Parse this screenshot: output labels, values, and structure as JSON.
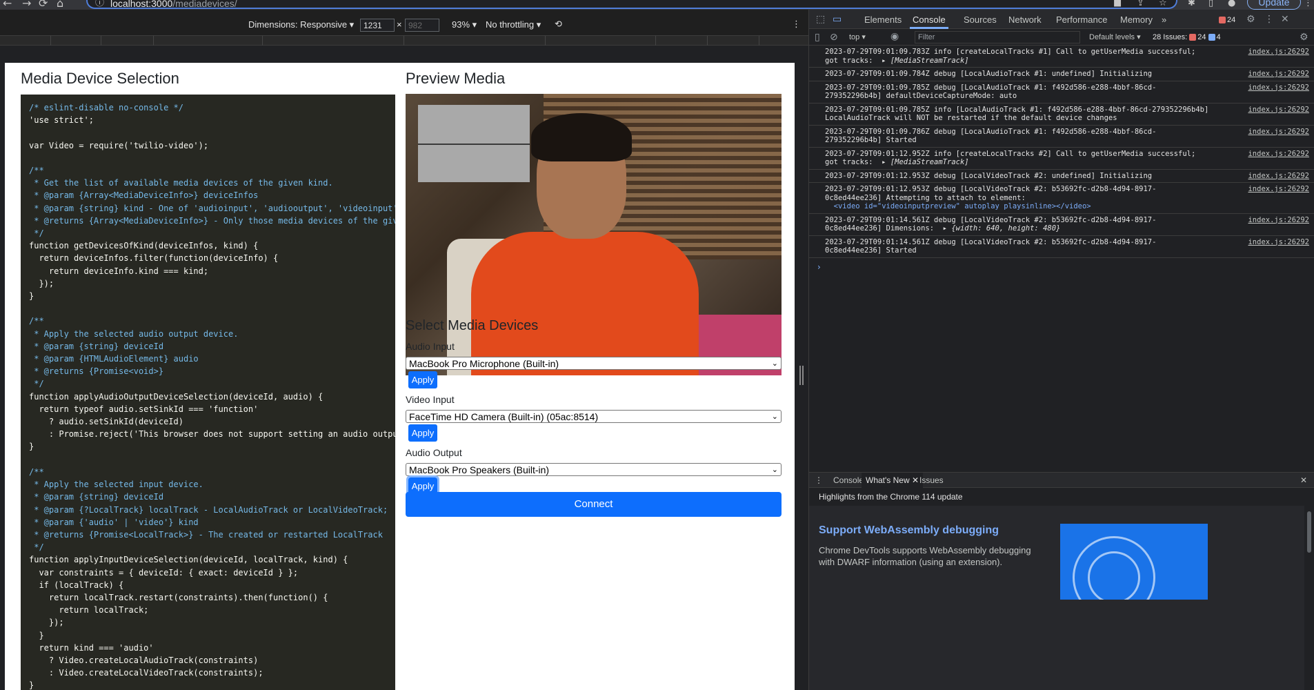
{
  "browser": {
    "url_host": "localhost:3000",
    "url_path": "/mediadevices/",
    "update_label": "Update"
  },
  "device_toolbar": {
    "dimensions_label": "Dimensions: Responsive ▾",
    "width": "1231",
    "height": "982",
    "times": "×",
    "zoom": "93% ▾",
    "throttling": "No throttling ▾"
  },
  "page": {
    "heading_left": "Media Device Selection",
    "heading_right": "Preview Media",
    "select_heading": "Select Media Devices",
    "audio_input_label": "Audio Input",
    "audio_input_value": "MacBook Pro Microphone (Built-in)",
    "video_input_label": "Video Input",
    "video_input_value": "FaceTime HD Camera (Built-in) (05ac:8514)",
    "audio_output_label": "Audio Output",
    "audio_output_value": "MacBook Pro Speakers (Built-in)",
    "apply_label": "Apply",
    "connect_label": "Connect"
  },
  "code_lines": [
    "/* eslint-disable no-console */",
    "'use strict';",
    "",
    "var Video = require('twilio-video');",
    "",
    "/**",
    " * Get the list of available media devices of the given kind.",
    " * @param {Array<MediaDeviceInfo>} deviceInfos",
    " * @param {string} kind - One of 'audioinput', 'audiooutput', 'videoinput'",
    " * @returns {Array<MediaDeviceInfo>} - Only those media devices of the given kind",
    " */",
    "function getDevicesOfKind(deviceInfos, kind) {",
    "  return deviceInfos.filter(function(deviceInfo) {",
    "    return deviceInfo.kind === kind;",
    "  });",
    "}",
    "",
    "/**",
    " * Apply the selected audio output device.",
    " * @param {string} deviceId",
    " * @param {HTMLAudioElement} audio",
    " * @returns {Promise<void>}",
    " */",
    "function applyAudioOutputDeviceSelection(deviceId, audio) {",
    "  return typeof audio.setSinkId === 'function'",
    "    ? audio.setSinkId(deviceId)",
    "    : Promise.reject('This browser does not support setting an audio output device');",
    "}",
    "",
    "/**",
    " * Apply the selected input device.",
    " * @param {string} deviceId",
    " * @param {?LocalTrack} localTrack - LocalAudioTrack or LocalVideoTrack;",
    " * @param {'audio' | 'video'} kind",
    " * @returns {Promise<LocalTrack>} - The created or restarted LocalTrack",
    " */",
    "function applyInputDeviceSelection(deviceId, localTrack, kind) {",
    "  var constraints = { deviceId: { exact: deviceId } };",
    "  if (localTrack) {",
    "    return localTrack.restart(constraints).then(function() {",
    "      return localTrack;",
    "    });",
    "  }",
    "  return kind === 'audio'",
    "    ? Video.createLocalAudioTrack(constraints)",
    "    : Video.createLocalVideoTrack(constraints);",
    "}"
  ],
  "devtools": {
    "tabs": [
      "Elements",
      "Console",
      "Sources",
      "Network",
      "Performance",
      "Memory"
    ],
    "more": "»",
    "error_count": "24",
    "context": "top ▾",
    "filter_placeholder": "Filter",
    "levels": "Default levels ▾",
    "issues_label": "28 Issues:",
    "issues_red": "24",
    "issues_blue": "4",
    "console_logs": [
      {
        "msg": "2023-07-29T09:01:09.783Z info [createLocalTracks #1] Call to getUserMedia successful;\ngot tracks:  ▸ ",
        "obj": "[MediaStreamTrack]",
        "src": "index.js:26292"
      },
      {
        "msg": "2023-07-29T09:01:09.784Z debug [LocalAudioTrack #1: undefined] Initializing",
        "obj": "",
        "src": "index.js:26292"
      },
      {
        "msg": "2023-07-29T09:01:09.785Z debug [LocalAudioTrack #1: f492d586-e288-4bbf-86cd-\n279352296b4b] defaultDeviceCaptureMode: auto",
        "obj": "",
        "src": "index.js:26292"
      },
      {
        "msg": "2023-07-29T09:01:09.785Z info [LocalAudioTrack #1: f492d586-e288-4bbf-86cd-279352296b4b]\nLocalAudioTrack will NOT be restarted if the default device changes",
        "obj": "",
        "src": "index.js:26292"
      },
      {
        "msg": "2023-07-29T09:01:09.786Z debug [LocalAudioTrack #1: f492d586-e288-4bbf-86cd-\n279352296b4b] Started",
        "obj": "",
        "src": "index.js:26292"
      },
      {
        "msg": "2023-07-29T09:01:12.952Z info [createLocalTracks #2] Call to getUserMedia successful;\ngot tracks:  ▸ ",
        "obj": "[MediaStreamTrack]",
        "src": "index.js:26292"
      },
      {
        "msg": "2023-07-29T09:01:12.953Z debug [LocalVideoTrack #2: undefined] Initializing",
        "obj": "",
        "src": "index.js:26292"
      },
      {
        "msg": "2023-07-29T09:01:12.953Z debug [LocalVideoTrack #2: b53692fc-d2b8-4d94-8917-\n0c8ed44ee236] Attempting to attach to element:",
        "obj": "",
        "tag": "  <video id=\"videoinputpreview\" autoplay playsinline></video>",
        "src": "index.js:26292"
      },
      {
        "msg": "2023-07-29T09:01:14.561Z debug [LocalVideoTrack #2: b53692fc-d2b8-4d94-8917-\n0c8ed44ee236] Dimensions:  ▸ ",
        "obj": "{width: 640, height: 480}",
        "src": "index.js:26292"
      },
      {
        "msg": "2023-07-29T09:01:14.561Z debug [LocalVideoTrack #2: b53692fc-d2b8-4d94-8917-\n0c8ed44ee236] Started",
        "obj": "",
        "src": "index.js:26292"
      }
    ],
    "drawer_tabs": [
      "Console",
      "What's New",
      "Issues"
    ],
    "highlights": "Highlights from the Chrome 114 update",
    "whats_new_title": "Support WebAssembly debugging",
    "whats_new_desc": "Chrome DevTools supports WebAssembly debugging with DWARF information (using an extension)."
  }
}
